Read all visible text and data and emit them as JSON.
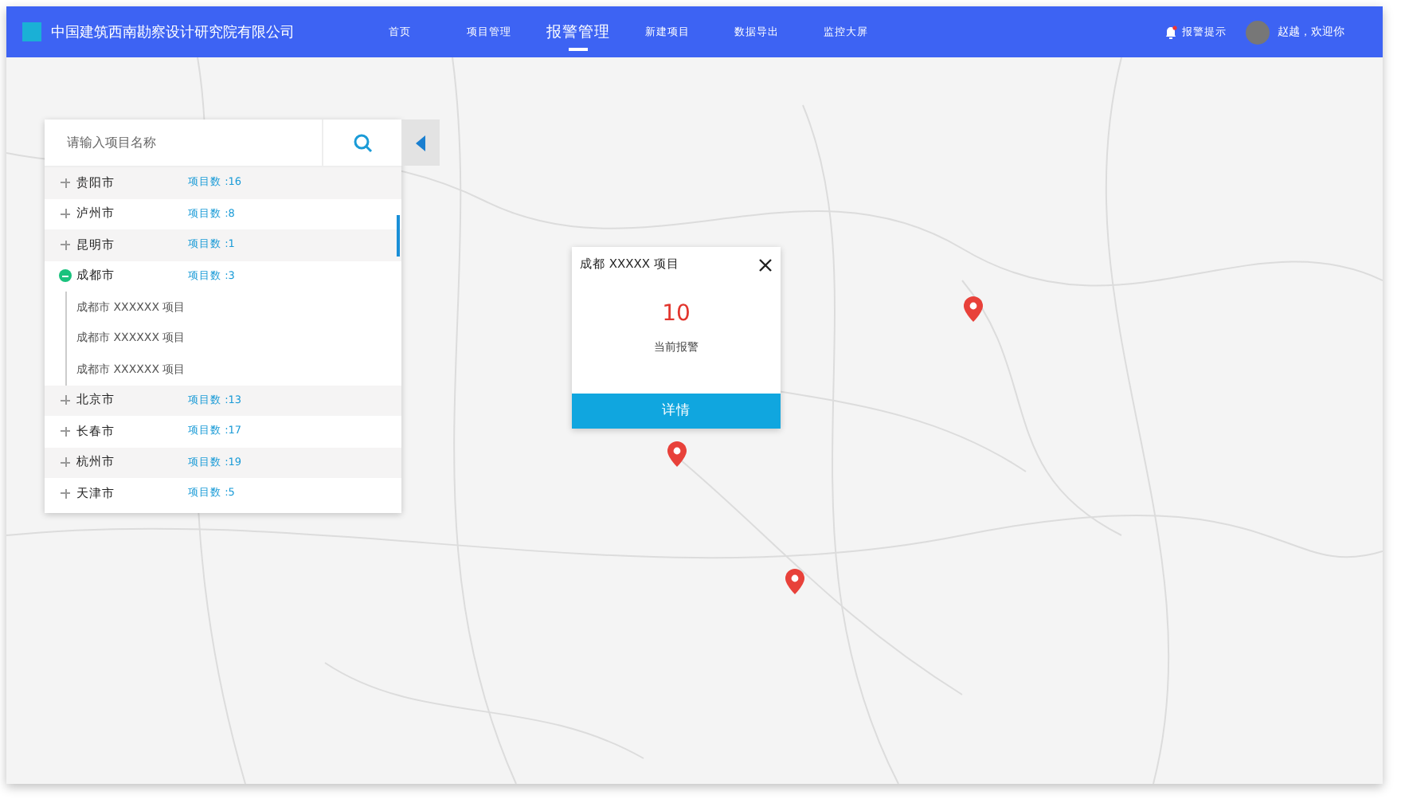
{
  "header": {
    "title": "中国建筑西南勘察设计研究院有限公司",
    "nav": [
      {
        "label": "首页",
        "selected": false
      },
      {
        "label": "项目管理",
        "selected": false
      },
      {
        "label": "报警管理",
        "selected": true
      },
      {
        "label": "新建项目",
        "selected": false
      },
      {
        "label": "数据导出",
        "selected": false
      },
      {
        "label": "监控大屏",
        "selected": false
      }
    ],
    "alert_label": "报警提示",
    "user": "赵越，欢迎你"
  },
  "sidebar": {
    "search": {
      "placeholder": "请输入项目名称"
    },
    "items": [
      {
        "name": "贵阳市",
        "count": "项目数 :16",
        "expanded": false
      },
      {
        "name": "泸州市",
        "count": "项目数 :8",
        "expanded": false
      },
      {
        "name": "昆明市",
        "count": "项目数 :1",
        "expanded": false
      },
      {
        "name": "成都市",
        "count": "项目数 :3",
        "expanded": true,
        "children": [
          {
            "label": "成都市 XXXXXX 项目"
          },
          {
            "label": "成都市 XXXXXX 项目"
          },
          {
            "label": "成都市 XXXXXX 项目"
          }
        ]
      },
      {
        "name": "北京市",
        "count": "项目数 :13",
        "expanded": false
      },
      {
        "name": "长春市",
        "count": "项目数 :17",
        "expanded": false
      },
      {
        "name": "杭州市",
        "count": "项目数 :19",
        "expanded": false
      },
      {
        "name": "天津市",
        "count": "项目数 :5",
        "expanded": false
      }
    ]
  },
  "popup": {
    "title": "成都 XXXXX 项目",
    "value": "10",
    "caption": "当前报警",
    "button": "详情"
  }
}
